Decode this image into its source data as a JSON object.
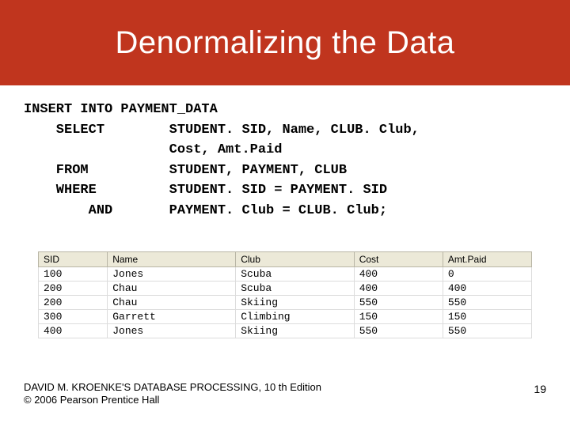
{
  "title": "Denormalizing the Data",
  "sql": {
    "line1": "INSERT INTO PAYMENT_DATA",
    "line2": "    SELECT        STUDENT. SID, Name, CLUB. Club,",
    "line3": "                  Cost, Amt.Paid",
    "line4": "    FROM          STUDENT, PAYMENT, CLUB",
    "line5": "    WHERE         STUDENT. SID = PAYMENT. SID",
    "line6": "        AND       PAYMENT. Club = CLUB. Club;"
  },
  "table": {
    "headers": [
      "SID",
      "Name",
      "Club",
      "Cost",
      "Amt.Paid"
    ],
    "rows": [
      [
        "100",
        "Jones",
        "Scuba",
        "400",
        "0"
      ],
      [
        "200",
        "Chau",
        "Scuba",
        "400",
        "400"
      ],
      [
        "200",
        "Chau",
        "Skiing",
        "550",
        "550"
      ],
      [
        "300",
        "Garrett",
        "Climbing",
        "150",
        "150"
      ],
      [
        "400",
        "Jones",
        "Skiing",
        "550",
        "550"
      ]
    ]
  },
  "footer": {
    "line1": "DAVID M. KROENKE'S DATABASE PROCESSING, 10 th Edition",
    "line2": "© 2006 Pearson Prentice Hall",
    "page": "19"
  }
}
